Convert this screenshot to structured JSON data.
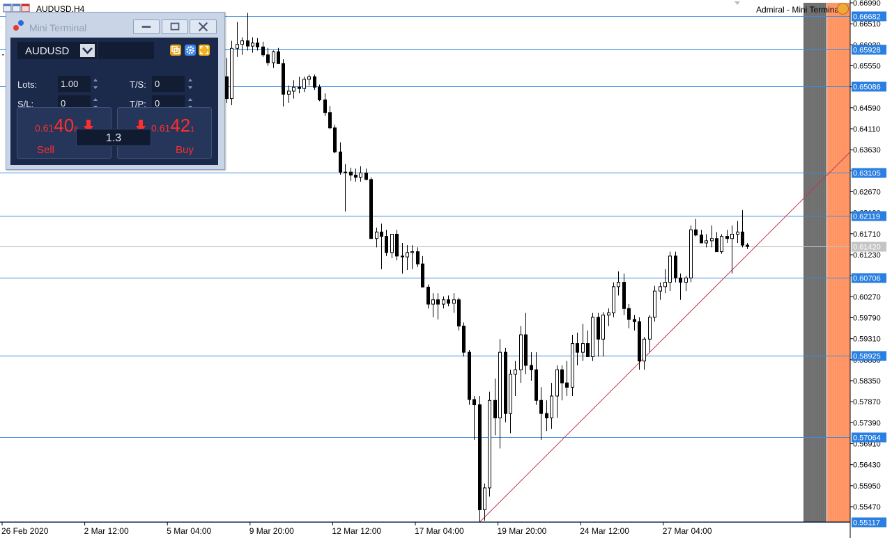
{
  "window": {
    "symbol_period": "AUDUSD,H4",
    "broker_label": "Admiral - Mini Terminal"
  },
  "mini_terminal": {
    "title": "Mini Terminal",
    "symbol": "AUDUSD",
    "lots_label": "Lots:",
    "lots_value": "1.00",
    "sl_label": "S/L:",
    "sl_value": "0",
    "ts_label": "T/S:",
    "ts_value": "0",
    "tp_label": "T/P:",
    "tp_value": "0",
    "sell": {
      "prefix": "0.61",
      "big": "40",
      "sup": "8",
      "label": "Sell"
    },
    "buy": {
      "prefix": "0.61",
      "big": "42",
      "sup": "1",
      "label": "Buy"
    },
    "spread": "1.3",
    "price_color": "#ff2e2e"
  },
  "chart_data": {
    "type": "candlestick",
    "symbol": "AUDUSD",
    "timeframe": "H4",
    "ylim": [
      0.5512,
      0.6699
    ],
    "y_ticks": [
      "0.66990",
      "0.66510",
      "0.66030",
      "0.65550",
      "0.65070",
      "0.64590",
      "0.64110",
      "0.63630",
      "0.63150",
      "0.62670",
      "0.62190",
      "0.61710",
      "0.61230",
      "0.60750",
      "0.60270",
      "0.59790",
      "0.59310",
      "0.58830",
      "0.58350",
      "0.57870",
      "0.57390",
      "0.56910",
      "0.56430",
      "0.55950",
      "0.55470"
    ],
    "x_labels": [
      "26 Feb 2020",
      "2 Mar 12:00",
      "5 Mar 04:00",
      "9 Mar 20:00",
      "12 Mar 12:00",
      "17 Mar 04:00",
      "19 Mar 20:00",
      "24 Mar 12:00",
      "27 Mar 04:00"
    ],
    "horizontal_levels": [
      "0.66682",
      "0.65928",
      "0.65086",
      "0.63105",
      "0.62119",
      "0.60706",
      "0.58925",
      "0.57064",
      "0.55117"
    ],
    "current_price": "0.61420",
    "trendline": {
      "from_price": 0.5512,
      "to_price": 0.6358
    },
    "candles": [
      [
        0.653,
        0.6573,
        0.647,
        0.648
      ],
      [
        0.648,
        0.6612,
        0.6465,
        0.6595
      ],
      [
        0.6595,
        0.6655,
        0.6575,
        0.6604
      ],
      [
        0.6604,
        0.662,
        0.658,
        0.6612
      ],
      [
        0.6612,
        0.6676,
        0.659,
        0.66
      ],
      [
        0.66,
        0.662,
        0.6585,
        0.6607
      ],
      [
        0.6607,
        0.6618,
        0.659,
        0.6598
      ],
      [
        0.6598,
        0.661,
        0.6575,
        0.658
      ],
      [
        0.658,
        0.6596,
        0.6555,
        0.6562
      ],
      [
        0.6562,
        0.659,
        0.655,
        0.6587
      ],
      [
        0.6587,
        0.6596,
        0.656,
        0.656
      ],
      [
        0.656,
        0.657,
        0.6462,
        0.649
      ],
      [
        0.649,
        0.651,
        0.647,
        0.6497
      ],
      [
        0.6497,
        0.6522,
        0.648,
        0.6506
      ],
      [
        0.6506,
        0.653,
        0.6492,
        0.6503
      ],
      [
        0.6503,
        0.653,
        0.6495,
        0.6524
      ],
      [
        0.6524,
        0.6535,
        0.651,
        0.653
      ],
      [
        0.653,
        0.6535,
        0.65,
        0.6506
      ],
      [
        0.6506,
        0.6512,
        0.6474,
        0.6477
      ],
      [
        0.6477,
        0.6492,
        0.644,
        0.6448
      ],
      [
        0.6448,
        0.6463,
        0.641,
        0.6413
      ],
      [
        0.6413,
        0.642,
        0.6355,
        0.6358
      ],
      [
        0.6358,
        0.638,
        0.6306,
        0.6312
      ],
      [
        0.6312,
        0.633,
        0.6222,
        0.6312
      ],
      [
        0.6312,
        0.6322,
        0.6292,
        0.6305
      ],
      [
        0.6305,
        0.632,
        0.629,
        0.63
      ],
      [
        0.63,
        0.6325,
        0.629,
        0.631
      ],
      [
        0.631,
        0.632,
        0.6293,
        0.6295
      ],
      [
        0.6295,
        0.63,
        0.6192,
        0.616
      ],
      [
        0.616,
        0.6185,
        0.614,
        0.6175
      ],
      [
        0.6175,
        0.6194,
        0.609,
        0.6165
      ],
      [
        0.6165,
        0.618,
        0.612,
        0.6128
      ],
      [
        0.6128,
        0.617,
        0.6115,
        0.617
      ],
      [
        0.617,
        0.618,
        0.611,
        0.612
      ],
      [
        0.612,
        0.615,
        0.608,
        0.6118
      ],
      [
        0.6118,
        0.6145,
        0.6088,
        0.6128
      ],
      [
        0.6128,
        0.6145,
        0.609,
        0.613
      ],
      [
        0.613,
        0.614,
        0.6095,
        0.6102
      ],
      [
        0.6102,
        0.612,
        0.606,
        0.6049
      ],
      [
        0.6049,
        0.6055,
        0.6,
        0.601
      ],
      [
        0.601,
        0.6035,
        0.598,
        0.602
      ],
      [
        0.602,
        0.6035,
        0.5975,
        0.601
      ],
      [
        0.601,
        0.6028,
        0.6,
        0.602
      ],
      [
        0.602,
        0.603,
        0.6005,
        0.6012
      ],
      [
        0.6012,
        0.6035,
        0.599,
        0.602
      ],
      [
        0.602,
        0.6025,
        0.595,
        0.596
      ],
      [
        0.596,
        0.5968,
        0.589,
        0.59
      ],
      [
        0.59,
        0.5905,
        0.578,
        0.5792
      ],
      [
        0.5792,
        0.58,
        0.57,
        0.578
      ],
      [
        0.578,
        0.58,
        0.5512,
        0.554
      ],
      [
        0.554,
        0.56,
        0.5515,
        0.559
      ],
      [
        0.559,
        0.581,
        0.557,
        0.579
      ],
      [
        0.579,
        0.584,
        0.571,
        0.575
      ],
      [
        0.575,
        0.593,
        0.568,
        0.59
      ],
      [
        0.59,
        0.591,
        0.574,
        0.576
      ],
      [
        0.576,
        0.586,
        0.5715,
        0.585
      ],
      [
        0.585,
        0.588,
        0.58,
        0.586
      ],
      [
        0.586,
        0.596,
        0.583,
        0.594
      ],
      [
        0.594,
        0.599,
        0.585,
        0.587
      ],
      [
        0.587,
        0.59,
        0.5835,
        0.586
      ],
      [
        0.586,
        0.59,
        0.578,
        0.579
      ],
      [
        0.579,
        0.582,
        0.57,
        0.576
      ],
      [
        0.576,
        0.579,
        0.572,
        0.575
      ],
      [
        0.575,
        0.583,
        0.5725,
        0.58
      ],
      [
        0.58,
        0.587,
        0.575,
        0.586
      ],
      [
        0.586,
        0.587,
        0.579,
        0.583
      ],
      [
        0.583,
        0.588,
        0.58,
        0.582
      ],
      [
        0.582,
        0.594,
        0.58,
        0.592
      ],
      [
        0.592,
        0.5945,
        0.587,
        0.59
      ],
      [
        0.59,
        0.5965,
        0.588,
        0.592
      ],
      [
        0.592,
        0.595,
        0.589,
        0.589
      ],
      [
        0.589,
        0.599,
        0.588,
        0.598
      ],
      [
        0.598,
        0.599,
        0.589,
        0.593
      ],
      [
        0.593,
        0.5992,
        0.589,
        0.5985
      ],
      [
        0.5985,
        0.6,
        0.596,
        0.599
      ],
      [
        0.599,
        0.606,
        0.598,
        0.605
      ],
      [
        0.605,
        0.6085,
        0.603,
        0.606
      ],
      [
        0.606,
        0.608,
        0.5985,
        0.6
      ],
      [
        0.6,
        0.601,
        0.5955,
        0.5975
      ],
      [
        0.5975,
        0.5985,
        0.595,
        0.597
      ],
      [
        0.597,
        0.598,
        0.586,
        0.588
      ],
      [
        0.588,
        0.5935,
        0.586,
        0.593
      ],
      [
        0.593,
        0.5985,
        0.59,
        0.598
      ],
      [
        0.598,
        0.6052,
        0.597,
        0.604
      ],
      [
        0.604,
        0.606,
        0.602,
        0.605
      ],
      [
        0.605,
        0.609,
        0.6035,
        0.606
      ],
      [
        0.606,
        0.613,
        0.604,
        0.612
      ],
      [
        0.612,
        0.613,
        0.606,
        0.607
      ],
      [
        0.607,
        0.608,
        0.602,
        0.606
      ],
      [
        0.606,
        0.6075,
        0.604,
        0.607
      ],
      [
        0.607,
        0.619,
        0.606,
        0.618
      ],
      [
        0.618,
        0.6205,
        0.6165,
        0.6168
      ],
      [
        0.6168,
        0.618,
        0.615,
        0.615
      ],
      [
        0.615,
        0.617,
        0.614,
        0.6155
      ],
      [
        0.6155,
        0.619,
        0.614,
        0.616
      ],
      [
        0.616,
        0.6175,
        0.613,
        0.613
      ],
      [
        0.613,
        0.617,
        0.6125,
        0.6165
      ],
      [
        0.6165,
        0.618,
        0.615,
        0.616
      ],
      [
        0.616,
        0.619,
        0.608,
        0.617
      ],
      [
        0.617,
        0.62,
        0.615,
        0.6175
      ],
      [
        0.6175,
        0.6225,
        0.614,
        0.6145
      ],
      [
        0.6145,
        0.615,
        0.6136,
        0.6142
      ]
    ]
  }
}
